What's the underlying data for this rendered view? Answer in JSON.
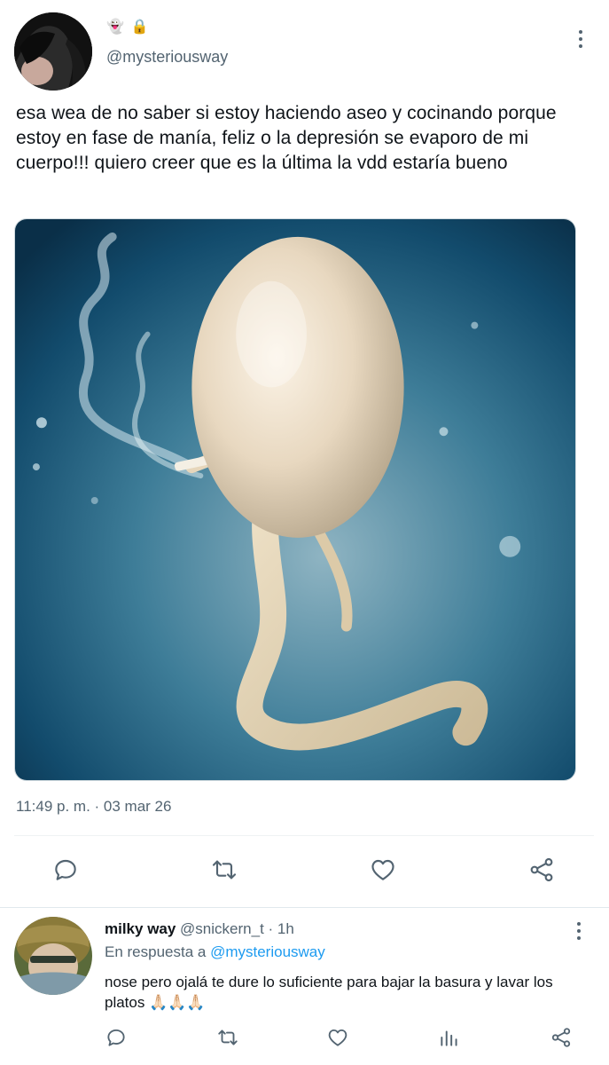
{
  "tweet": {
    "name_icons": [
      "👻",
      "🔒"
    ],
    "handle": "@mysteriousway",
    "text": "esa wea de no saber si estoy haciendo aseo y cocinando porque estoy en fase de manía, feliz o la depresión se evaporo de mi cuerpo!!! quiero creer que es la última la vdd estaría bueno",
    "timestamp": "11:49 p. m. · 03 mar 26",
    "media_icon": "smoking-sperm-illustration"
  },
  "actions_main": [
    "reply-icon",
    "retweet-icon",
    "like-icon",
    "share-icon"
  ],
  "reply": {
    "name": "milky way",
    "meta": " @snickern_t · 1h",
    "replying_prefix": "En respuesta a ",
    "replying_handle": "@mysteriousway",
    "text": "nose pero ojalá te dure lo suficiente para bajar la basura y lavar los platos 🙏🏻🙏🏻🙏🏻"
  },
  "actions_reply": [
    "reply-icon",
    "retweet-icon",
    "like-icon",
    "views-icon",
    "share-icon"
  ],
  "colors": {
    "text": "#0f1419",
    "secondary": "#536471",
    "accent": "#1d9bf0",
    "divider": "#eff3f4"
  }
}
